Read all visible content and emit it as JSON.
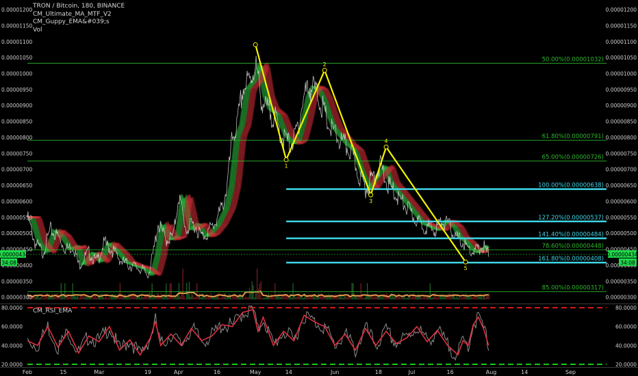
{
  "legend": {
    "title": "TRON / Bitcoin, 180, BINANCE",
    "indicator1": "CM_Ultimate_MA_MTF_V2",
    "indicator2": "CM_Guppy_EMA&#039;s",
    "indicator3": "Vol"
  },
  "rsi_label": "CM_RSI_EMA",
  "price_tag": "0.00000434",
  "countdown": "34:08",
  "colors": {
    "background": "#000000",
    "fib_green": "#2eb82e",
    "fib_cyan": "#3fd6e6",
    "wave_yellow": "#f5f500",
    "ribbon_red": "#e0303a",
    "ribbon_green": "#2ecc40",
    "volume_line": "#e89a4c",
    "rsi_line": "#e03040",
    "rsi_upper": "#e01818",
    "rsi_lower": "#18d018",
    "price_tag_bg": "#1ed84a"
  },
  "chart_data": [
    {
      "type": "line",
      "title": "TRON / Bitcoin, 180, BINANCE",
      "y_ticks": [
        "0.00001200",
        "0.00001150",
        "0.00001100",
        "0.00001050",
        "0.00001000",
        "0.00000950",
        "0.00000900",
        "0.00000850",
        "0.00000800",
        "0.00000750",
        "0.00000700",
        "0.00000650",
        "0.00000600",
        "0.00000550",
        "0.00000500",
        "0.00000450",
        "0.00000400",
        "0.00000350",
        "0.00000300"
      ],
      "x_ticks": [
        "Feb",
        "15",
        "Mar",
        "19",
        "Apr",
        "16",
        "May",
        "14",
        "Jun",
        "18",
        "Jul",
        "16",
        "Aug",
        "14",
        "Sep"
      ],
      "ylim": [
        2.8e-06,
        1.23e-05
      ],
      "x_range_days": [
        0,
        226
      ],
      "x_tick_days": [
        0,
        14,
        28,
        47,
        59,
        74,
        89,
        102,
        120,
        137,
        150,
        165,
        181,
        194,
        212
      ],
      "price_series": {
        "day": [
          0,
          3,
          6,
          9,
          12,
          15,
          18,
          20,
          24,
          27,
          30,
          34,
          37,
          40,
          44,
          47,
          49,
          51,
          54,
          57,
          59,
          62,
          65,
          68,
          70,
          73,
          76,
          78,
          80,
          82,
          84,
          87,
          89,
          91,
          93,
          96,
          99,
          102,
          104,
          106,
          108,
          110,
          112,
          114,
          116,
          118,
          120,
          123,
          126,
          129,
          132,
          135,
          138,
          140,
          142,
          145,
          148,
          150,
          153,
          156,
          159,
          162,
          165,
          167,
          170,
          172,
          174,
          176,
          178,
          180
        ],
        "value": [
          5.5e-06,
          4.7e-06,
          4.4e-06,
          5.1e-06,
          4.9e-06,
          4.5e-06,
          4.6e-06,
          4e-06,
          4.4e-06,
          4.1e-06,
          4.7e-06,
          4.4e-06,
          4.1e-06,
          4e-06,
          3.9e-06,
          3.7e-06,
          4.3e-06,
          5.3e-06,
          4.8e-06,
          4.9e-06,
          6.2e-06,
          5.1e-06,
          5.3e-06,
          4.9e-06,
          5e-06,
          5.3e-06,
          5.8e-06,
          6.5e-06,
          8e-06,
          8.4e-06,
          9.5e-06,
          9.8e-06,
          1.03e-05,
          9.3e-06,
          8.9e-06,
          8.7e-06,
          8.1e-06,
          7.8e-06,
          7.9e-06,
          8.5e-06,
          9.3e-06,
          9.6e-06,
          9.5e-06,
          9.2e-06,
          8.7e-06,
          8.3e-06,
          8.1e-06,
          7.8e-06,
          7.6e-06,
          6.9e-06,
          6.4e-06,
          6.8e-06,
          7.1e-06,
          6.6e-06,
          6.4e-06,
          6.1e-06,
          5.8e-06,
          5.6e-06,
          5.3e-06,
          5.2e-06,
          5.1e-06,
          5.4e-06,
          5.2e-06,
          4.9e-06,
          4.7e-06,
          4.5e-06,
          4.4e-06,
          4.5e-06,
          4.6e-06,
          4.3e-06
        ]
      },
      "wave_points": [
        {
          "label": "",
          "day": 89,
          "value": 1.09e-05
        },
        {
          "label": "1",
          "day": 101,
          "value": 7.3e-06
        },
        {
          "label": "2",
          "day": 116,
          "value": 1.01e-05
        },
        {
          "label": "3",
          "day": 134,
          "value": 6.2e-06
        },
        {
          "label": "4",
          "day": 140,
          "value": 7.7e-06
        },
        {
          "label": "5",
          "day": 171,
          "value": 4.1e-06
        }
      ],
      "fib_levels": [
        {
          "label": "50.00%(0.00001032)",
          "value": 1.032e-05,
          "color": "green",
          "start_day": 0
        },
        {
          "label": "61.80%(0.00000791)",
          "value": 7.91e-06,
          "color": "green",
          "start_day": 0
        },
        {
          "label": "65.00%(0.00000726)",
          "value": 7.26e-06,
          "color": "green",
          "start_day": 0
        },
        {
          "label": "100.00%(0.00000638)",
          "value": 6.38e-06,
          "color": "cyan",
          "start_day": 101
        },
        {
          "label": "127.20%(0.00000537)",
          "value": 5.37e-06,
          "color": "cyan",
          "start_day": 101
        },
        {
          "label": "141.40%(0.00000484)",
          "value": 4.84e-06,
          "color": "cyan",
          "start_day": 101
        },
        {
          "label": "78.60%(0.00000448)",
          "value": 4.48e-06,
          "color": "green",
          "start_day": 0
        },
        {
          "label": "161.80%(0.00000408)",
          "value": 4.08e-06,
          "color": "cyan",
          "start_day": 101
        },
        {
          "label": "85.00%(0.00000317)",
          "value": 3.17e-06,
          "color": "green",
          "start_day": 0
        }
      ],
      "current_price": 4.34e-06
    },
    {
      "type": "line",
      "title": "CM_RSI_EMA",
      "y_ticks": [
        "80.0000",
        "60.0000",
        "40.0000",
        "20.0000"
      ],
      "ylim": [
        17,
        83
      ],
      "upper_level": 80,
      "lower_level": 20,
      "rsi_series": {
        "day": [
          0,
          4,
          8,
          12,
          16,
          20,
          24,
          28,
          32,
          36,
          40,
          44,
          48,
          50,
          52,
          56,
          60,
          64,
          68,
          72,
          76,
          80,
          84,
          88,
          90,
          92,
          96,
          100,
          104,
          108,
          112,
          116,
          120,
          124,
          128,
          132,
          136,
          140,
          144,
          148,
          152,
          156,
          160,
          164,
          168,
          170,
          172,
          174,
          176,
          178,
          180
        ],
        "value": [
          45,
          40,
          60,
          38,
          55,
          32,
          50,
          44,
          60,
          35,
          46,
          30,
          48,
          66,
          40,
          52,
          40,
          58,
          45,
          50,
          62,
          60,
          75,
          78,
          55,
          70,
          40,
          55,
          45,
          72,
          65,
          60,
          40,
          52,
          35,
          58,
          40,
          55,
          42,
          48,
          60,
          44,
          56,
          40,
          30,
          45,
          40,
          62,
          70,
          58,
          40
        ]
      }
    }
  ]
}
